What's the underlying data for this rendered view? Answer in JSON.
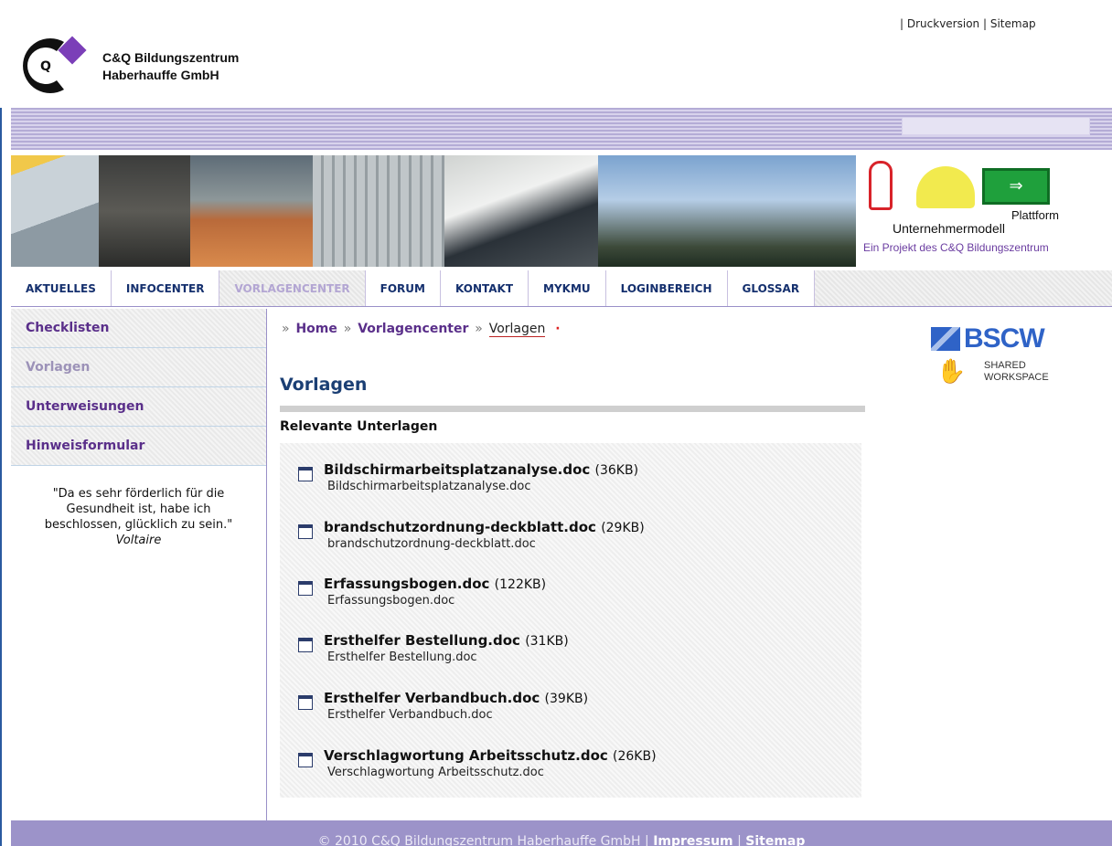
{
  "header": {
    "brand_line1": "C&Q Bildungszentrum",
    "brand_line2": "Haberhauffe GmbH",
    "toplinks": {
      "sep1": "|",
      "druck": "Druckversion",
      "sep2": "|",
      "sitemap": "Sitemap"
    }
  },
  "banner": {
    "platform_line1": "Plattform",
    "platform_line2": "Unternehmermodell",
    "project_text": "Ein Projekt des C&Q Bildungszentrum"
  },
  "nav": {
    "tabs": [
      {
        "label": "AKTUELLES"
      },
      {
        "label": "INFOCENTER"
      },
      {
        "label": "VORLAGENCENTER"
      },
      {
        "label": "FORUM"
      },
      {
        "label": "KONTAKT"
      },
      {
        "label": "MYKMU"
      },
      {
        "label": "LOGINBEREICH"
      },
      {
        "label": "GLOSSAR"
      }
    ],
    "active": "VORLAGENCENTER"
  },
  "sidebar": {
    "items": [
      {
        "label": "Checklisten"
      },
      {
        "label": "Vorlagen"
      },
      {
        "label": "Unterweisungen"
      },
      {
        "label": "Hinweisformular"
      }
    ],
    "quote_line1": "\"Da es sehr förderlich für die",
    "quote_line2": "Gesundheit ist, habe ich",
    "quote_line3": "beschlossen, glücklich zu sein.\"",
    "quote_author": "Voltaire"
  },
  "breadcrumb": {
    "sep": "»",
    "home": "Home",
    "center": "Vorlagencenter",
    "current": "Vorlagen",
    "dot": "·"
  },
  "main": {
    "title": "Vorlagen",
    "section": "Relevante Unterlagen",
    "files": [
      {
        "name": "Bildschirmarbeitsplatzanalyse.doc",
        "size": "(36KB)",
        "desc": "Bildschirmarbeitsplatzanalyse.doc"
      },
      {
        "name": "brandschutzordnung-deckblatt.doc",
        "size": "(29KB)",
        "desc": "brandschutzordnung-deckblatt.doc"
      },
      {
        "name": "Erfassungsbogen.doc",
        "size": "(122KB)",
        "desc": "Erfassungsbogen.doc"
      },
      {
        "name": "Ersthelfer Bestellung.doc",
        "size": "(31KB)",
        "desc": "Ersthelfer Bestellung.doc"
      },
      {
        "name": "Ersthelfer Verbandbuch.doc",
        "size": "(39KB)",
        "desc": "Ersthelfer Verbandbuch.doc"
      },
      {
        "name": "Verschlagwortung Arbeitsschutz.doc",
        "size": "(26KB)",
        "desc": "Verschlagwortung Arbeitsschutz.doc"
      }
    ]
  },
  "bscw": {
    "logo": "BSCW",
    "sub1": "SHARED",
    "sub2": "WORKSPACE"
  },
  "footer": {
    "copyright": "© 2010 C&Q Bildungszentrum Haberhauffe GmbH",
    "sep": "|",
    "impressum": "Impressum",
    "sitemap": "Sitemap"
  },
  "colors": {
    "accent": "#5a2f8a",
    "nav": "#15306e",
    "footer": "#9c93c9",
    "title": "#1b3f74"
  }
}
